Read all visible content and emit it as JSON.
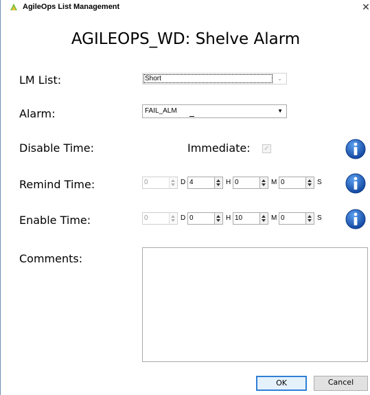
{
  "window": {
    "title": "AgileOps List Management",
    "close": "✕"
  },
  "heading": "AGILEOPS_WD: Shelve Alarm",
  "lm_list": {
    "label": "LM List:",
    "value": "Short"
  },
  "alarm": {
    "label": "Alarm:",
    "value": "FAIL_ALM"
  },
  "disable_time": {
    "label": "Disable Time:",
    "immediate_label": "Immediate:",
    "immediate_checked": true
  },
  "remind_time": {
    "label": "Remind Time:",
    "days": "0",
    "hours": "4",
    "minutes": "0",
    "seconds": "0"
  },
  "enable_time": {
    "label": "Enable Time:",
    "days": "0",
    "hours": "0",
    "minutes": "10",
    "seconds": "0"
  },
  "units": {
    "d": "D",
    "h": "H",
    "m": "M",
    "s": "S"
  },
  "comments": {
    "label": "Comments:",
    "value": ""
  },
  "buttons": {
    "ok": "OK",
    "cancel": "Cancel"
  },
  "icons": {
    "app": "agileops-logo-icon",
    "info": "info-icon",
    "check": "checkmark-icon"
  },
  "colors": {
    "info_blue": "#1a5fb4",
    "ok_border": "#2f7fd6"
  }
}
